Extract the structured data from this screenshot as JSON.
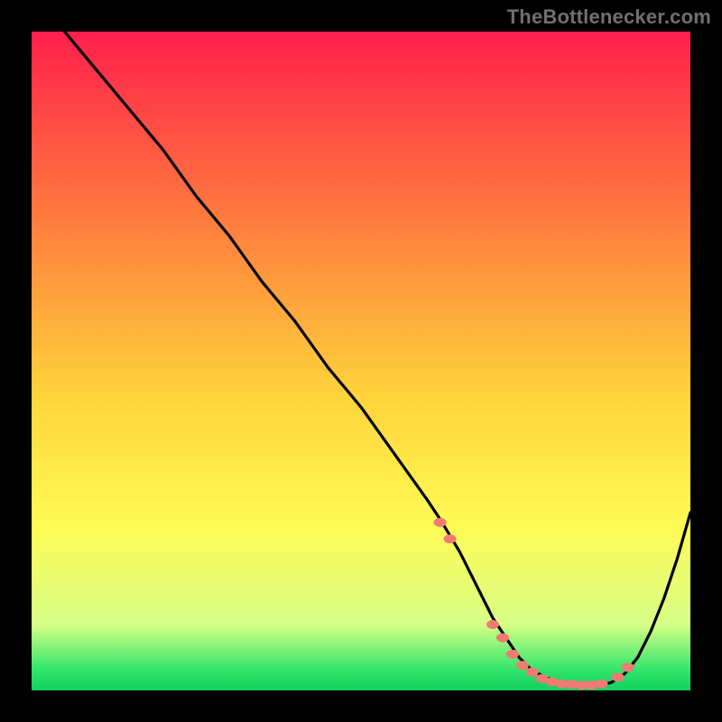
{
  "attribution": "TheBottlenecker.com",
  "colors": {
    "background": "#000000",
    "curve": "#000000",
    "marker": "#ef7b72",
    "gradient_top": "#ff1f4b",
    "gradient_mid_upper": "#ff7a3e",
    "gradient_mid": "#ffd33c",
    "gradient_mid_lower": "#fffb55",
    "gradient_green_pale": "#d7ff87",
    "gradient_green": "#2fe56a",
    "gradient_green_bottom": "#13cf5d"
  },
  "chart_data": {
    "type": "line",
    "title": "",
    "xlabel": "",
    "ylabel": "",
    "xlim": [
      0,
      100
    ],
    "ylim": [
      0,
      100
    ],
    "grid": false,
    "legend": false,
    "series": [
      {
        "name": "bottleneck-curve",
        "x": [
          0,
          5,
          10,
          15,
          20,
          25,
          30,
          35,
          40,
          45,
          50,
          55,
          60,
          62,
          65,
          68,
          70,
          72,
          74,
          76,
          78,
          80,
          82,
          84,
          86,
          88,
          90,
          92,
          94,
          96,
          98,
          100
        ],
        "y": [
          null,
          100,
          94,
          88,
          82,
          75,
          69,
          62,
          56,
          49,
          43,
          36,
          29,
          26,
          21,
          15,
          11,
          8,
          5,
          3,
          2,
          1.2,
          0.8,
          0.6,
          0.7,
          1.2,
          2.5,
          5,
          9,
          14,
          20,
          27
        ]
      }
    ],
    "highlight_points": {
      "name": "optimal-range-markers",
      "x": [
        62,
        63.5,
        70,
        71.5,
        73,
        74.5,
        76,
        77.5,
        79,
        80.5,
        82,
        83.5,
        85,
        86.5,
        89,
        90.5
      ],
      "y": [
        25.5,
        23,
        10,
        8,
        5.5,
        3.8,
        2.8,
        1.8,
        1.3,
        1.0,
        0.9,
        0.8,
        0.8,
        1.0,
        2.0,
        3.5
      ]
    }
  }
}
